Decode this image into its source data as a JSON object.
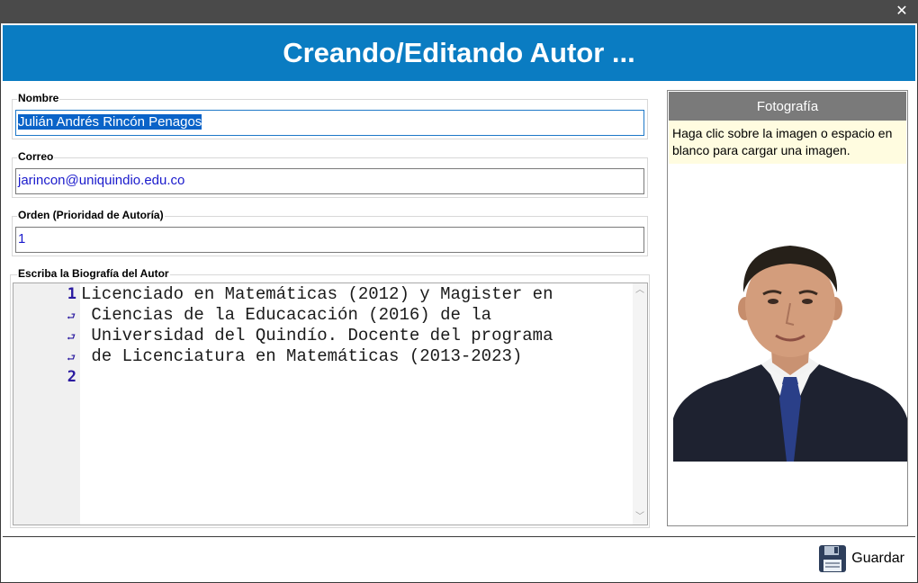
{
  "window": {
    "close_icon": "close-icon"
  },
  "header": {
    "title": "Creando/Editando Autor ..."
  },
  "form": {
    "nombre": {
      "label": "Nombre",
      "value": "Julián Andrés Rincón Penagos"
    },
    "correo": {
      "label": "Correo",
      "value": "jarincon@uniquindio.edu.co"
    },
    "orden": {
      "label": "Orden (Prioridad de Autoría)",
      "value": "1"
    },
    "biografia": {
      "label": "Escriba la Biografía del Autor",
      "line_numbers": [
        "1",
        "2"
      ],
      "lines": [
        "Licenciado en Matemáticas (2012) y Magister en",
        " Ciencias de la Educacación (2016) de la",
        " Universidad del Quindío. Docente del programa",
        " de Licenciatura en Matemáticas (2013-2023)"
      ]
    }
  },
  "photo": {
    "title": "Fotografía",
    "hint": "Haga clic sobre la imagen o espacio en blanco para cargar una imagen."
  },
  "footer": {
    "save_label": "Guardar",
    "save_icon": "floppy-disk-icon"
  },
  "colors": {
    "header_bg": "#0a7cc2",
    "title_bar": "#4a4a4a",
    "hint_bg": "#fffce0"
  }
}
